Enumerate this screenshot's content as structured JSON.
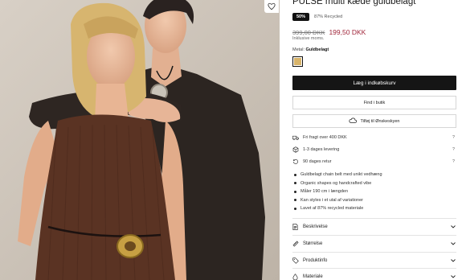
{
  "product": {
    "title": "PULSE multi kæde guldbelagt",
    "discount_badge": "50%",
    "recycled_badge": "87% Recycled",
    "price_old": "399,00 DKK",
    "price_new": "199,50 DKK",
    "vat_note": "Inklusive moms.",
    "metal_label": "Metal:",
    "metal_value": "Guldbelagt",
    "swatch_color": "#d8b46a"
  },
  "actions": {
    "add_to_cart": "Læg i indkøbskurv",
    "find_in_store": "Find i butik",
    "add_to_wishlist": "Tilføj til Ønskeskyen"
  },
  "shipping": [
    {
      "icon": "truck-icon",
      "text": "Fri fragt over 400 DKK"
    },
    {
      "icon": "box-icon",
      "text": "1-3 dages levering"
    },
    {
      "icon": "return-icon",
      "text": "90 dages retur"
    }
  ],
  "features": [
    "Guldbelagt chain belt med unikt vedhæng",
    "Organic shapes og handcrafted vibe",
    "Måler 190 cm i længden",
    "Kan styles i et utal af variationer",
    "Lavet af 87% recycled materiale"
  ],
  "accordion": [
    {
      "icon": "document-icon",
      "label": "Beskrivelse"
    },
    {
      "icon": "ruler-icon",
      "label": "Størrelse"
    },
    {
      "icon": "tag-icon",
      "label": "Produktinfo"
    },
    {
      "icon": "drop-icon",
      "label": "Materiale"
    }
  ],
  "colors": {
    "primary_button": "#151515",
    "sale_price": "#a0263a"
  }
}
